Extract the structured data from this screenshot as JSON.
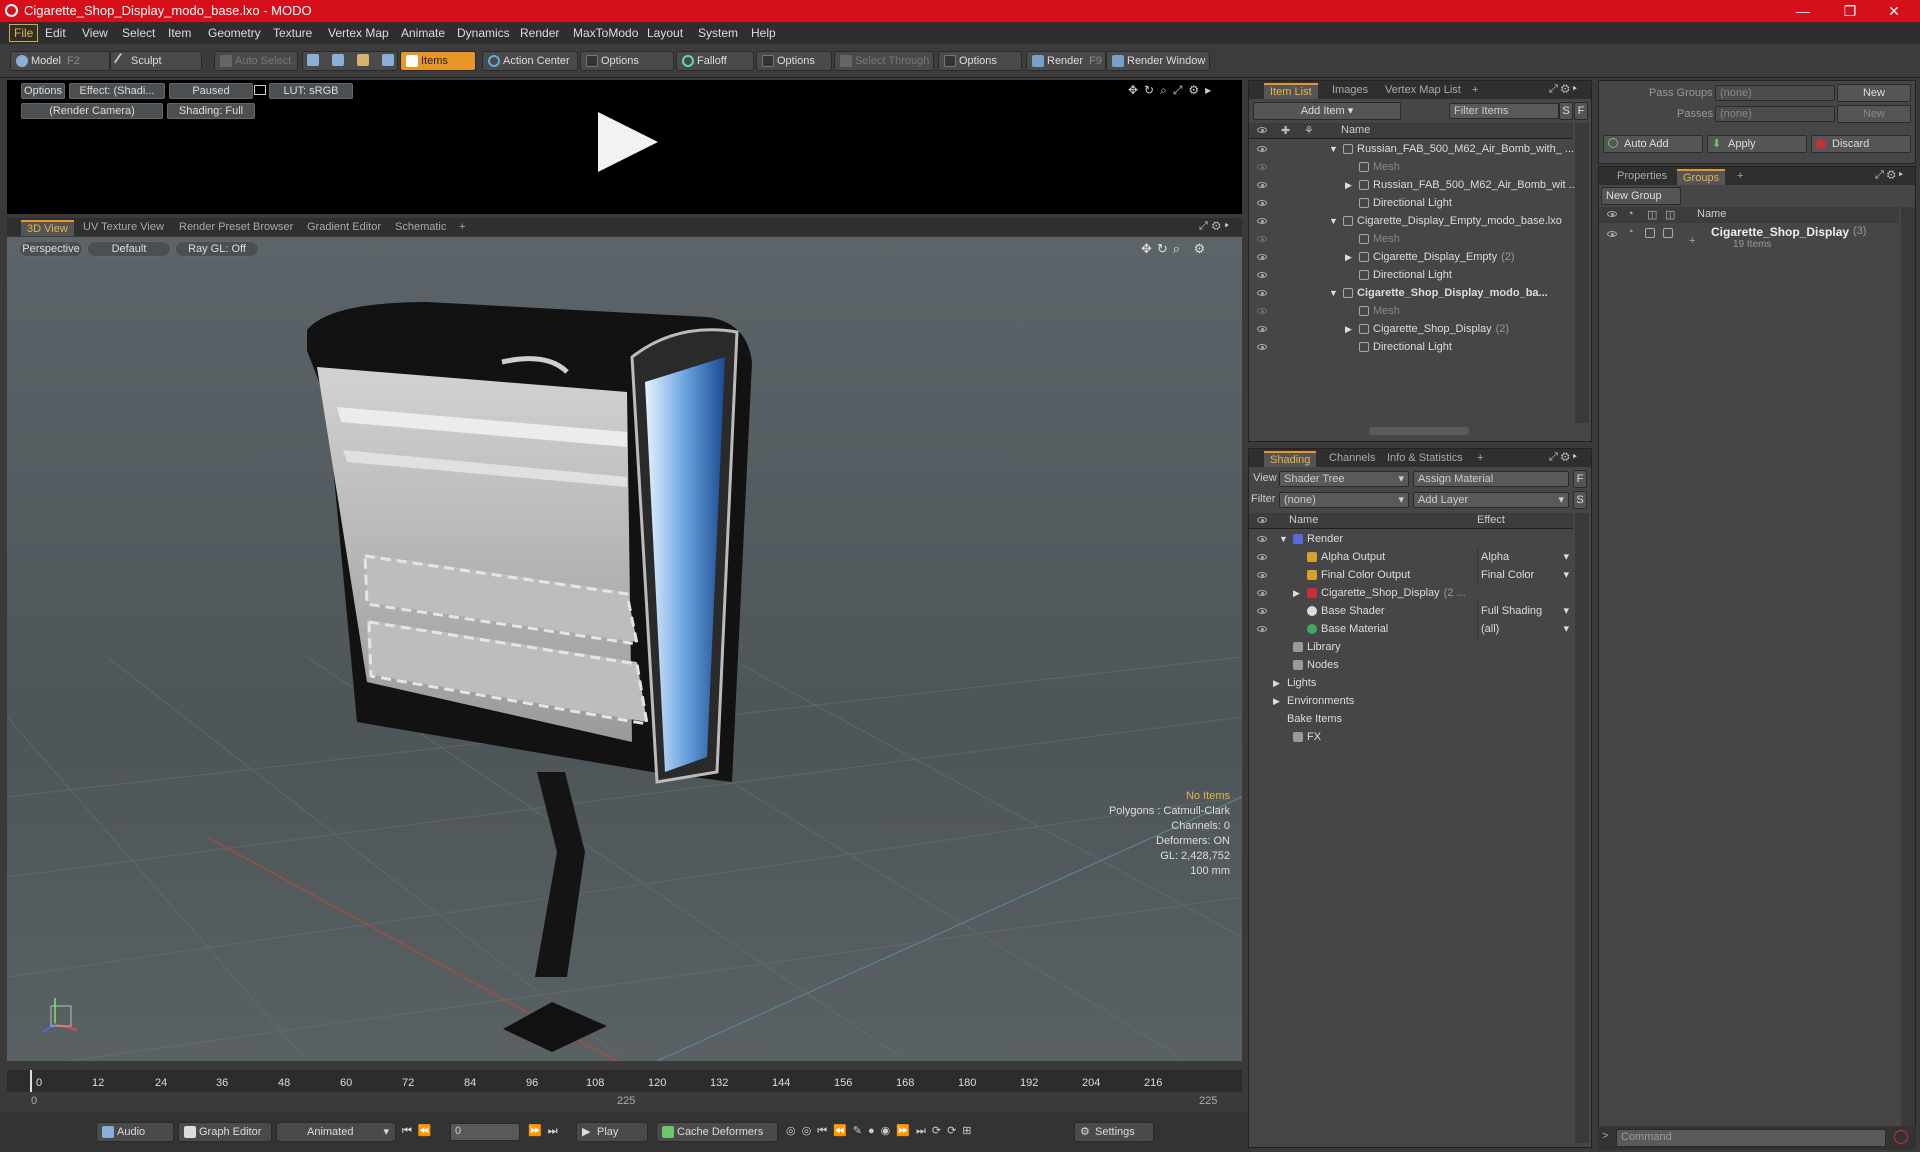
{
  "window": {
    "title": "Cigarette_Shop_Display_modo_base.lxo - MODO",
    "minimize": "—",
    "maximize": "❐",
    "close": "✕"
  },
  "menu": [
    "File",
    "Edit",
    "View",
    "Select",
    "Item",
    "Geometry",
    "Texture",
    "Vertex Map",
    "Animate",
    "Dynamics",
    "Render",
    "MaxToModo",
    "Layout",
    "System",
    "Help"
  ],
  "toolbar": {
    "model": "Model",
    "model_key": "F2",
    "sculpt": "Sculpt",
    "auto_select": "Auto Select",
    "items": "Items",
    "action_center": "Action Center",
    "options1": "Options",
    "falloff": "Falloff",
    "options2": "Options",
    "select_through": "Select Through",
    "options3": "Options",
    "render": "Render",
    "render_key": "F9",
    "render_window": "Render Window"
  },
  "preview": {
    "options": "Options",
    "effect": "Effect: (Shadi...",
    "paused": "Paused",
    "lut": "LUT: sRGB",
    "camera": "(Render Camera)",
    "shading": "Shading: Full"
  },
  "view_tabs": [
    "3D View",
    "UV Texture View",
    "Render Preset Browser",
    "Gradient Editor",
    "Schematic",
    "+"
  ],
  "viewport": {
    "perspective": "Perspective",
    "default": "Default",
    "raygl": "Ray GL: Off",
    "no_items": "No Items",
    "polygons": "Polygons : Catmull-Clark",
    "channels": "Channels: 0",
    "deformers": "Deformers: ON",
    "gl": "GL: 2,428,752",
    "scale": "100 mm"
  },
  "item_list": {
    "tabs": [
      "Item List",
      "Images",
      "Vertex Map List",
      "+"
    ],
    "add_item": "Add Item",
    "filter": "Filter Items",
    "s": "S",
    "f": "F",
    "col_name": "Name",
    "rows": [
      {
        "label": "Russian_FAB_500_M62_Air_Bomb_with_ ...",
        "indent": 0,
        "arrow": "▼",
        "dim": false,
        "bold": false
      },
      {
        "label": "Mesh",
        "indent": 1,
        "arrow": "",
        "dim": true,
        "bold": false
      },
      {
        "label": "Russian_FAB_500_M62_Air_Bomb_wit ...",
        "indent": 1,
        "arrow": "▶",
        "dim": false,
        "bold": false
      },
      {
        "label": "Directional Light",
        "indent": 1,
        "arrow": "",
        "dim": false,
        "bold": false
      },
      {
        "label": "Cigarette_Display_Empty_modo_base.lxo",
        "indent": 0,
        "arrow": "▼",
        "dim": false,
        "bold": false
      },
      {
        "label": "Mesh",
        "indent": 1,
        "arrow": "",
        "dim": true,
        "bold": false
      },
      {
        "label": "Cigarette_Display_Empty",
        "count": "(2)",
        "indent": 1,
        "arrow": "▶",
        "dim": false,
        "bold": false
      },
      {
        "label": "Directional Light",
        "indent": 1,
        "arrow": "",
        "dim": false,
        "bold": false
      },
      {
        "label": "Cigarette_Shop_Display_modo_ba...",
        "indent": 0,
        "arrow": "▼",
        "dim": false,
        "bold": true
      },
      {
        "label": "Mesh",
        "indent": 1,
        "arrow": "",
        "dim": true,
        "bold": false
      },
      {
        "label": "Cigarette_Shop_Display",
        "count": "(2)",
        "indent": 1,
        "arrow": "▶",
        "dim": false,
        "bold": false
      },
      {
        "label": "Directional Light",
        "indent": 1,
        "arrow": "",
        "dim": false,
        "bold": false
      }
    ]
  },
  "shading": {
    "tabs": [
      "Shading",
      "Channels",
      "Info & Statistics",
      "+"
    ],
    "view_label": "View",
    "view_value": "Shader Tree",
    "assign": "Assign Material",
    "filter_label": "Filter",
    "filter_value": "(none)",
    "add_layer": "Add Layer",
    "col_name": "Name",
    "col_effect": "Effect",
    "rows": [
      {
        "label": "Render",
        "effect": "",
        "indent": 0,
        "arrow": "▼",
        "color": "#5a6ad8"
      },
      {
        "label": "Alpha Output",
        "effect": "Alpha",
        "indent": 1,
        "arrow": "",
        "color": "#d8a030"
      },
      {
        "label": "Final Color Output",
        "effect": "Final Color",
        "indent": 1,
        "arrow": "",
        "color": "#d8a030"
      },
      {
        "label": "Cigarette_Shop_Display",
        "count": "(2 ...",
        "effect": "",
        "indent": 1,
        "arrow": "▶",
        "color": "#c83030"
      },
      {
        "label": "Base Shader",
        "effect": "Full Shading",
        "indent": 1,
        "arrow": "",
        "color": "#dddddd"
      },
      {
        "label": "Base Material",
        "effect": "(all)",
        "indent": 1,
        "arrow": "",
        "color": "#40a860"
      },
      {
        "label": "Library",
        "effect": "",
        "indent": 0,
        "arrow": "",
        "color": "#999999"
      },
      {
        "label": "Nodes",
        "effect": "",
        "indent": 0,
        "arrow": "",
        "color": "#999999"
      },
      {
        "label": "Lights",
        "effect": "",
        "indent": -1,
        "arrow": "▶",
        "color": ""
      },
      {
        "label": "Environments",
        "effect": "",
        "indent": -1,
        "arrow": "▶",
        "color": ""
      },
      {
        "label": "Bake Items",
        "effect": "",
        "indent": -1,
        "arrow": "",
        "color": ""
      },
      {
        "label": "FX",
        "effect": "",
        "indent": 0,
        "arrow": "",
        "color": "#999999"
      }
    ]
  },
  "right": {
    "pass_groups": "Pass Groups",
    "passes": "Passes",
    "none1": "(none)",
    "none2": "(none)",
    "new1": "New",
    "new2": "New",
    "auto_add": "Auto Add",
    "apply": "Apply",
    "discard": "Discard",
    "tabs": [
      "Properties",
      "Groups",
      "+"
    ],
    "new_group": "New Group",
    "col_name": "Name",
    "group_name": "Cigarette_Shop_Display",
    "group_count": "(3)",
    "group_items": "19 Items",
    "command": "Command"
  },
  "timeline": {
    "ticks": [
      "0",
      "12",
      "24",
      "36",
      "48",
      "60",
      "72",
      "84",
      "96",
      "108",
      "120",
      "132",
      "144",
      "156",
      "168",
      "180",
      "192",
      "204",
      "216"
    ],
    "start": "0",
    "mid": "225",
    "end": "225"
  },
  "bottom": {
    "audio": "Audio",
    "graph_editor": "Graph Editor",
    "animated": "Animated",
    "frame": "0",
    "play": "Play",
    "cache": "Cache Deformers",
    "settings": "Settings"
  },
  "colors": {
    "accent": "#e8962a",
    "title_bg": "#d5101a"
  }
}
